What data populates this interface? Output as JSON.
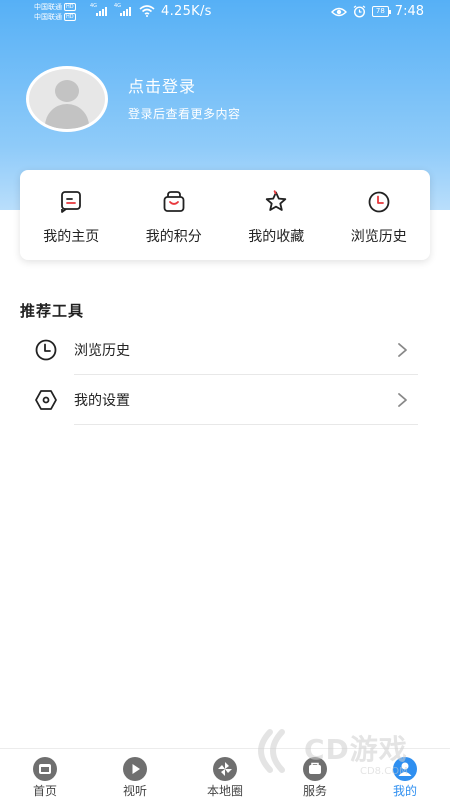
{
  "status_bar": {
    "carrier_1": "中国联通",
    "carrier_2": "中国联通",
    "hd_badge": "HD",
    "net_type": "4G",
    "net_speed": "4.25K/s",
    "battery": "78",
    "time": "7:48"
  },
  "profile": {
    "login_title": "点击登录",
    "login_subtitle": "登录后查看更多内容"
  },
  "quick_actions": [
    {
      "label": "我的主页",
      "icon": "homepage-icon"
    },
    {
      "label": "我的积分",
      "icon": "shopping-bag-icon"
    },
    {
      "label": "我的收藏",
      "icon": "star-icon"
    },
    {
      "label": "浏览历史",
      "icon": "clock-icon"
    }
  ],
  "tools": {
    "title": "推荐工具",
    "items": [
      {
        "label": "浏览历史",
        "icon": "clock-icon"
      },
      {
        "label": "我的设置",
        "icon": "settings-hexagon-icon"
      }
    ]
  },
  "bottom_nav": {
    "items": [
      {
        "label": "首页",
        "icon": "home-icon"
      },
      {
        "label": "视听",
        "icon": "play-icon"
      },
      {
        "label": "本地圈",
        "icon": "pinwheel-icon"
      },
      {
        "label": "服务",
        "icon": "service-icon"
      },
      {
        "label": "我的",
        "icon": "user-icon"
      }
    ],
    "active_index": 4
  },
  "watermark": {
    "text": "CD游戏",
    "sub": "CD8.COM"
  },
  "colors": {
    "header_top": "#56b0f6",
    "header_bottom": "#b9defb",
    "accent": "#2f8ff0",
    "badge_red": "#e8383d"
  }
}
